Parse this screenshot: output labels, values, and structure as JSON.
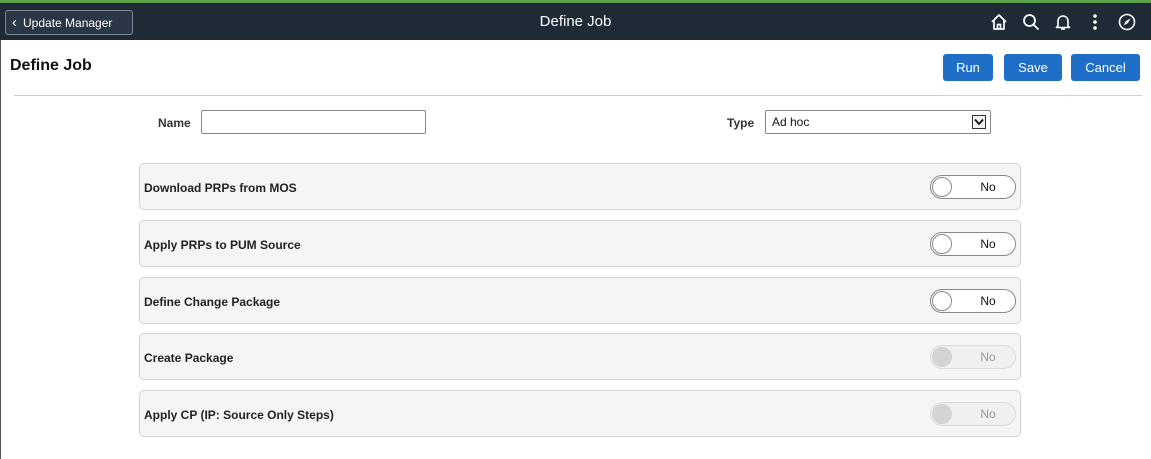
{
  "header": {
    "back_label": "Update Manager",
    "title": "Define Job",
    "icons": [
      "home-icon",
      "search-icon",
      "bell-icon",
      "more-vertical-icon",
      "navigator-icon"
    ]
  },
  "page": {
    "title": "Define Job",
    "buttons": {
      "run": "Run",
      "save": "Save",
      "cancel": "Cancel"
    }
  },
  "form": {
    "name_label": "Name",
    "name_value": "",
    "type_label": "Type",
    "type_value": "Ad hoc"
  },
  "steps": [
    {
      "label": "Download PRPs from MOS",
      "toggle": "No",
      "enabled": true
    },
    {
      "label": "Apply PRPs to PUM Source",
      "toggle": "No",
      "enabled": true
    },
    {
      "label": "Define Change Package",
      "toggle": "No",
      "enabled": true
    },
    {
      "label": "Create Package",
      "toggle": "No",
      "enabled": false
    },
    {
      "label": "Apply CP (IP: Source Only Steps)",
      "toggle": "No",
      "enabled": false
    }
  ],
  "colors": {
    "banner": "#1f2a37",
    "primary_button": "#1f6fc8",
    "accent_strip": "#5aa34a"
  }
}
